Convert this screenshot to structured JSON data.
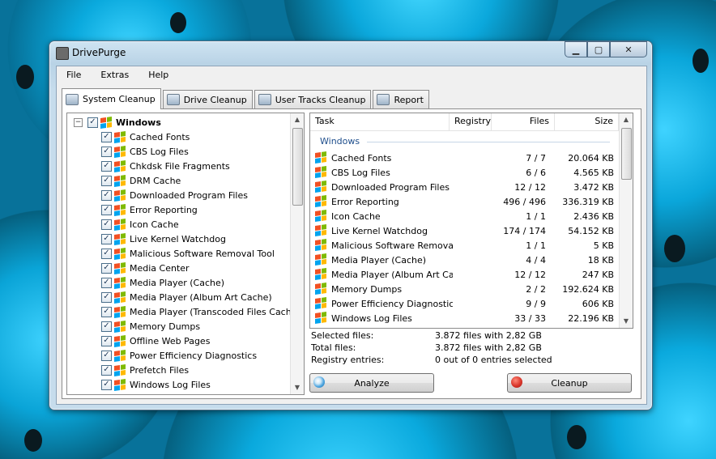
{
  "window": {
    "title": "DrivePurge"
  },
  "menu": [
    "File",
    "Extras",
    "Help"
  ],
  "tabs": [
    {
      "label": "System Cleanup",
      "icon": "broom-icon"
    },
    {
      "label": "Drive Cleanup",
      "icon": "drive-icon"
    },
    {
      "label": "User Tracks Cleanup",
      "icon": "user-tracks-icon"
    },
    {
      "label": "Report",
      "icon": "report-icon"
    }
  ],
  "tree": {
    "root": "Windows",
    "items": [
      "Cached Fonts",
      "CBS Log Files",
      "Chkdsk File Fragments",
      "DRM Cache",
      "Downloaded Program Files",
      "Error Reporting",
      "Icon Cache",
      "Live Kernel Watchdog",
      "Malicious Software Removal Tool",
      "Media Center",
      "Media Player (Cache)",
      "Media Player (Album Art Cache)",
      "Media Player (Transcoded Files Cache)",
      "Memory Dumps",
      "Offline Web Pages",
      "Power Efficiency Diagnostics",
      "Prefetch Files",
      "Windows Log Files"
    ]
  },
  "list": {
    "columns": [
      "Task",
      "Registry",
      "Files",
      "Size"
    ],
    "group": "Windows",
    "rows": [
      {
        "name": "Cached Fonts",
        "files": "7 / 7",
        "size": "20.064 KB"
      },
      {
        "name": "CBS Log Files",
        "files": "6 / 6",
        "size": "4.565 KB"
      },
      {
        "name": "Downloaded Program Files",
        "files": "12 / 12",
        "size": "3.472 KB"
      },
      {
        "name": "Error Reporting",
        "files": "496 / 496",
        "size": "336.319 KB"
      },
      {
        "name": "Icon Cache",
        "files": "1 / 1",
        "size": "2.436 KB"
      },
      {
        "name": "Live Kernel Watchdog",
        "files": "174 / 174",
        "size": "54.152 KB"
      },
      {
        "name": "Malicious Software Removal...",
        "files": "1 / 1",
        "size": "5 KB"
      },
      {
        "name": "Media Player (Cache)",
        "files": "4 / 4",
        "size": "18 KB"
      },
      {
        "name": "Media Player (Album Art Ca...",
        "files": "12 / 12",
        "size": "247 KB"
      },
      {
        "name": "Memory Dumps",
        "files": "2 / 2",
        "size": "192.624 KB"
      },
      {
        "name": "Power Efficiency Diagnostics",
        "files": "9 / 9",
        "size": "606 KB"
      },
      {
        "name": "Windows Log Files",
        "files": "33 / 33",
        "size": "22.196 KB"
      }
    ]
  },
  "stats": {
    "selected_label": "Selected files:",
    "selected_value": "3.872 files with 2,82 GB",
    "total_label": "Total files:",
    "total_value": "3.872 files with 2,82 GB",
    "registry_label": "Registry entries:",
    "registry_value": "0 out of 0 entries selected"
  },
  "buttons": {
    "analyze": "Analyze",
    "cleanup": "Cleanup"
  },
  "colors": {
    "group_header": "#1e4e8c",
    "cleanup_icon": "#d9362b",
    "analyze_icon": "#4aa3df"
  }
}
